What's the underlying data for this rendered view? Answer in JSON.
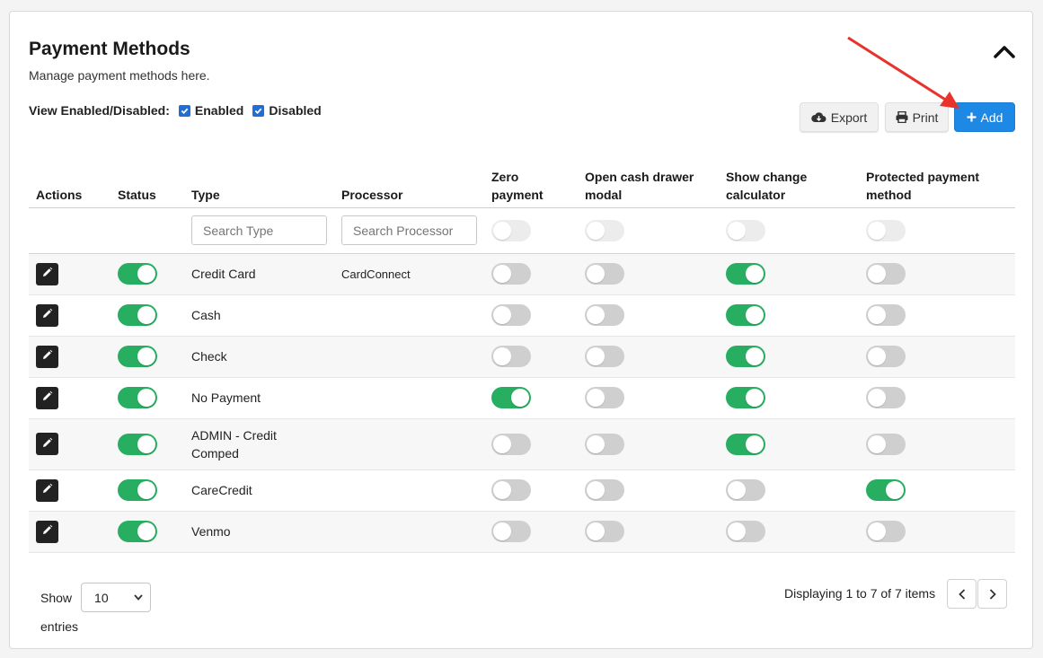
{
  "header": {
    "title": "Payment Methods",
    "subtitle": "Manage payment methods here."
  },
  "filter": {
    "label": "View Enabled/Disabled:",
    "enabled_label": "Enabled",
    "enabled_checked": true,
    "disabled_label": "Disabled",
    "disabled_checked": true
  },
  "toolbar": {
    "export_label": "Export",
    "print_label": "Print",
    "add_label": "Add"
  },
  "table": {
    "columns": [
      {
        "label": "Actions"
      },
      {
        "label": "Status"
      },
      {
        "label": "Type"
      },
      {
        "label": "Processor"
      },
      {
        "label": "Zero payment"
      },
      {
        "label": "Open cash drawer modal"
      },
      {
        "label": "Show change calculator"
      },
      {
        "label": "Protected payment method"
      }
    ],
    "search": {
      "type_placeholder": "Search Type",
      "processor_placeholder": "Search Processor"
    },
    "rows": [
      {
        "status": true,
        "type": "Credit Card",
        "processor": "CardConnect",
        "zero_payment": false,
        "open_cash_drawer": false,
        "show_change": true,
        "protected": false
      },
      {
        "status": true,
        "type": "Cash",
        "processor": "",
        "zero_payment": false,
        "open_cash_drawer": false,
        "show_change": true,
        "protected": false
      },
      {
        "status": true,
        "type": "Check",
        "processor": "",
        "zero_payment": false,
        "open_cash_drawer": false,
        "show_change": true,
        "protected": false
      },
      {
        "status": true,
        "type": "No Payment",
        "processor": "",
        "zero_payment": true,
        "open_cash_drawer": false,
        "show_change": true,
        "protected": false
      },
      {
        "status": true,
        "type": "ADMIN - Credit Comped",
        "processor": "",
        "zero_payment": false,
        "open_cash_drawer": false,
        "show_change": true,
        "protected": false
      },
      {
        "status": true,
        "type": "CareCredit",
        "processor": "",
        "zero_payment": false,
        "open_cash_drawer": false,
        "show_change": false,
        "protected": true
      },
      {
        "status": true,
        "type": "Venmo",
        "processor": "",
        "zero_payment": false,
        "open_cash_drawer": false,
        "show_change": false,
        "protected": false
      }
    ]
  },
  "footer": {
    "show_label": "Show",
    "page_size": "10",
    "entries_label": "entries",
    "displaying": "Displaying 1 to 7 of 7 items"
  },
  "colors": {
    "accent": "#1e88e5",
    "toggle_on": "#27ae60",
    "toggle_off": "#cfcfcf",
    "annotation_arrow": "#e8322b"
  }
}
